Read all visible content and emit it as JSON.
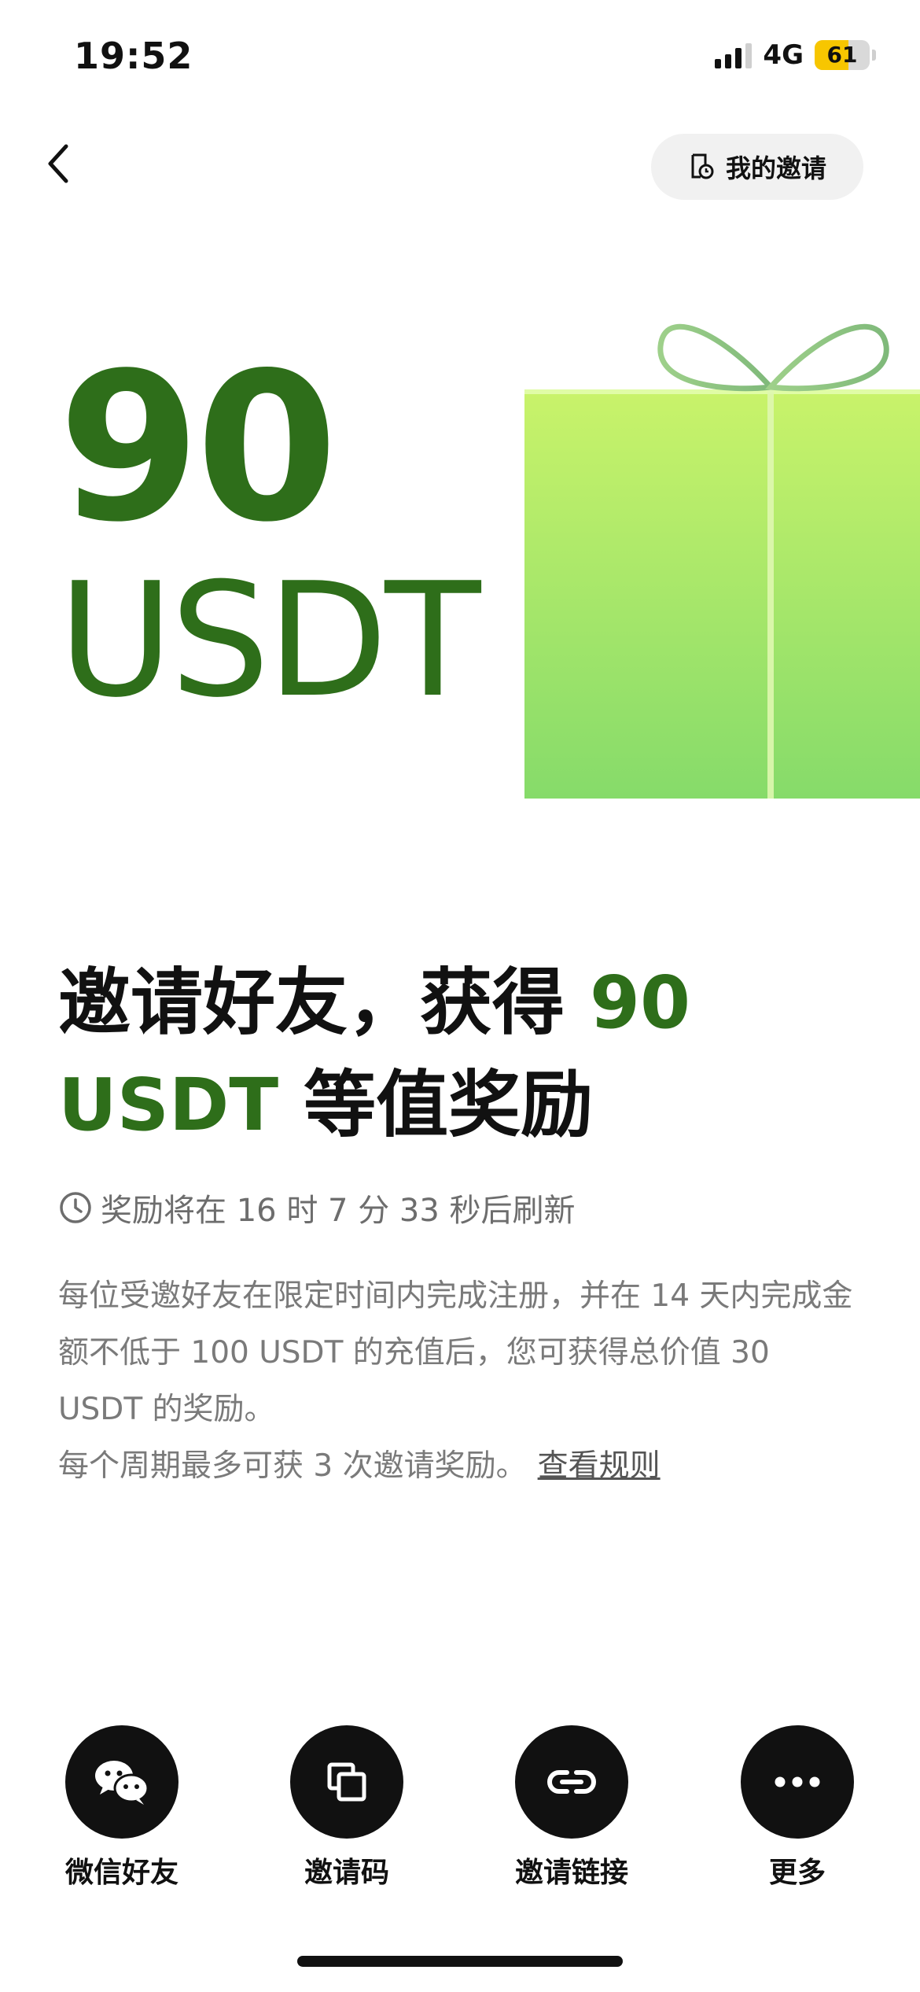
{
  "status_bar": {
    "time": "19:52",
    "network": "4G",
    "battery": "61"
  },
  "nav": {
    "my_invites_label": "我的邀请"
  },
  "hero": {
    "amount": "90",
    "unit": "USDT",
    "accent_color": "#2e6e1a"
  },
  "headline": {
    "prefix": "邀请好友，获得 ",
    "accent_1": "90",
    "accent_2": "USDT",
    "suffix": " 等值奖励"
  },
  "countdown": {
    "text": "奖励将在 16 时 7 分 33 秒后刷新"
  },
  "description": {
    "paragraph": "每位受邀好友在限定时间内完成注册，并在 14 天内完成金额不低于 100 USDT 的充值后，您可获得总价值 30 USDT 的奖励。",
    "limit": "每个周期最多可获 3 次邀请奖励。",
    "rules_link": "查看规则"
  },
  "share": {
    "items": [
      {
        "label": "微信好友",
        "icon": "wechat-icon"
      },
      {
        "label": "邀请码",
        "icon": "copy-icon"
      },
      {
        "label": "邀请链接",
        "icon": "link-icon"
      },
      {
        "label": "更多",
        "icon": "more-icon"
      }
    ]
  }
}
